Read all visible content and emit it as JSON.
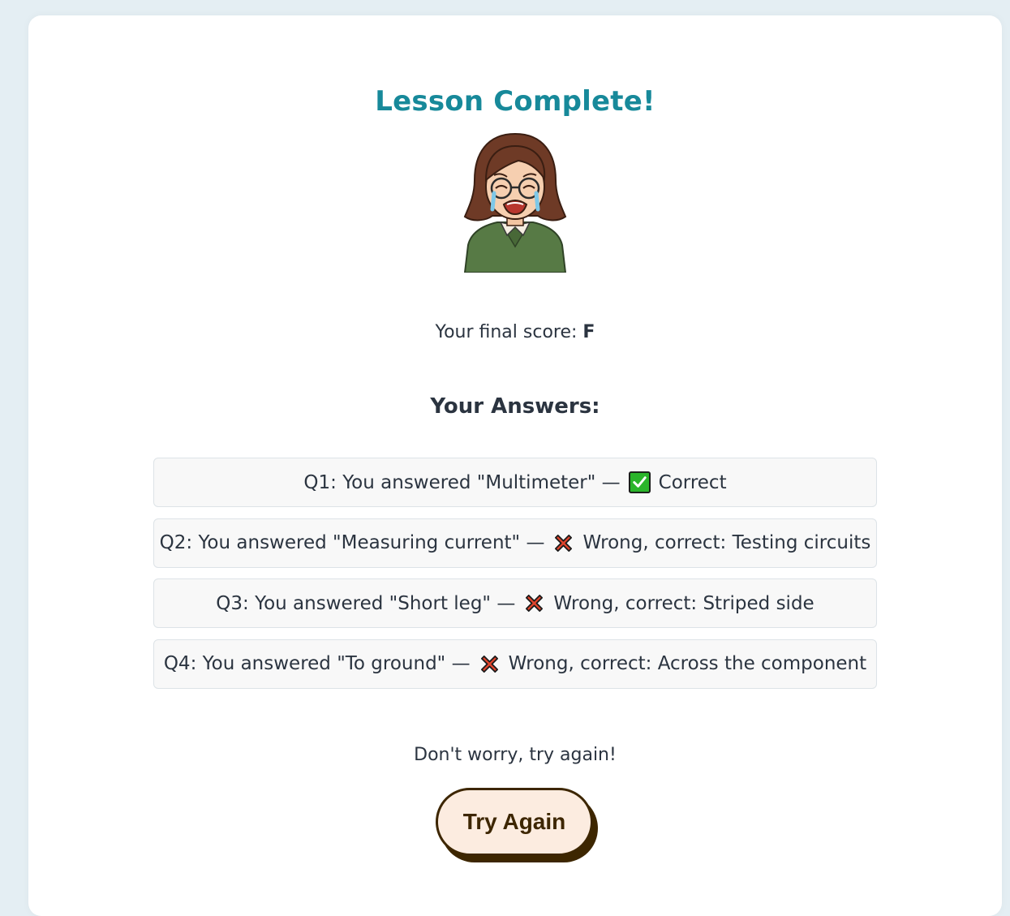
{
  "header": {
    "title": "Lesson Complete!"
  },
  "avatar": {
    "icon": "crying-teacher-avatar"
  },
  "score": {
    "label": "Your final score: ",
    "grade": "F"
  },
  "answers": {
    "heading": "Your Answers:",
    "items": [
      {
        "prefix": "Q1: You answered \"Multimeter\" —",
        "status": "correct",
        "icon": "check-icon",
        "result": "Correct"
      },
      {
        "prefix": "Q2: You answered \"Measuring current\" —",
        "status": "wrong",
        "icon": "cross-icon",
        "result": "Wrong, correct: Testing circuits"
      },
      {
        "prefix": "Q3: You answered \"Short leg\" —",
        "status": "wrong",
        "icon": "cross-icon",
        "result": "Wrong, correct: Striped side"
      },
      {
        "prefix": "Q4: You answered \"To ground\" —",
        "status": "wrong",
        "icon": "cross-icon",
        "result": "Wrong, correct: Across the component"
      }
    ]
  },
  "footer": {
    "message": "Don't worry, try again!",
    "button_label": "Try Again"
  },
  "colors": {
    "title": "#17899a",
    "button_bg": "#fcece0",
    "button_border": "#3d2600",
    "correct": "#2ab52a",
    "wrong": "#e0442c"
  }
}
